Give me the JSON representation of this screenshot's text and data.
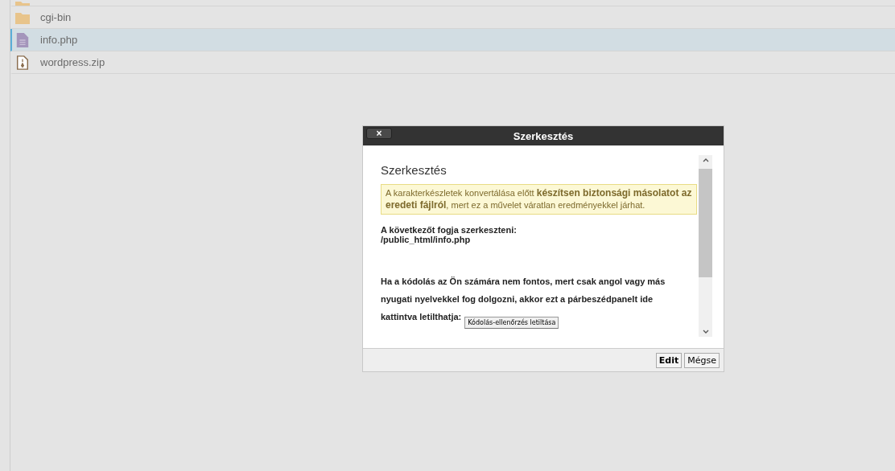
{
  "files": [
    {
      "kind": "folder",
      "selected": false
    },
    {
      "kind": "folder",
      "name": "cgi-bin",
      "selected": false
    },
    {
      "kind": "text",
      "name": "info.php",
      "selected": true
    },
    {
      "kind": "archive",
      "name": "wordpress.zip",
      "selected": false
    }
  ],
  "dialog": {
    "title": "Szerkesztés",
    "close": "×",
    "heading": "Szerkesztés",
    "warning": "A karakterkészletek konvertálása előtt **készítsen biztonsági másolatot az eredeti fájlról**, mert ez a művelet váratlan eredményekkel járhat.",
    "edit_label": "A következőt fogja szerkeszteni:",
    "path": "/public_html/info.php",
    "note": "Ha a kódolás az Ön számára nem fontos, mert csak angol vagy más nyugati nyelvekkel fog dolgozni, akkor ezt a párbeszédpanelt ide",
    "note_end": "kattintva letilthatja:",
    "disable_button": "Kódolás-ellenőrzés letiltása",
    "buttons": [
      "Edit",
      "Mégse"
    ]
  }
}
